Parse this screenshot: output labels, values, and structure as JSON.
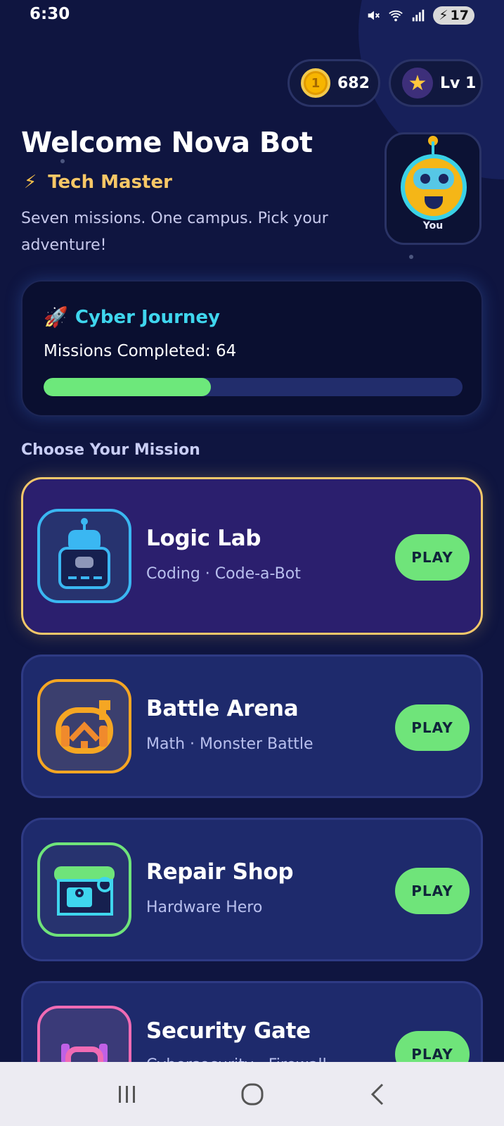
{
  "status_bar": {
    "time": "6:30",
    "battery": "17"
  },
  "header": {
    "coins": "682",
    "level": "Lv 1",
    "welcome": "Welcome Nova Bot",
    "rank": "Tech Master",
    "tagline": "Seven missions. One campus. Pick your adventure!",
    "avatar_label": "You"
  },
  "journey": {
    "title": "Cyber Journey",
    "missions_completed": "Missions Completed: 64",
    "progress_fraction": 0.4
  },
  "missions_section": {
    "title": "Choose Your Mission",
    "items": [
      {
        "title": "Logic Lab",
        "subtitle": "Coding · Code-a-Bot",
        "play_label": "PLAY",
        "icon": "robot-icon",
        "accent": "#3ab7f2"
      },
      {
        "title": "Battle Arena",
        "subtitle": "Math · Monster Battle",
        "play_label": "PLAY",
        "icon": "monster-icon",
        "accent": "#f5a623"
      },
      {
        "title": "Repair Shop",
        "subtitle": "Hardware Hero",
        "play_label": "PLAY",
        "icon": "repair-icon",
        "accent": "#6fe47a"
      },
      {
        "title": "Security Gate",
        "subtitle": "Cybersecurity · Firewall",
        "play_label": "PLAY",
        "icon": "shield-icon",
        "accent": "#f06bb4"
      }
    ]
  },
  "colors": {
    "background": "#0f1540",
    "accent_cyan": "#3fd6ee",
    "accent_gold": "#f7c766",
    "play_green": "#6fe47a",
    "progress_green": "#6de87b"
  }
}
